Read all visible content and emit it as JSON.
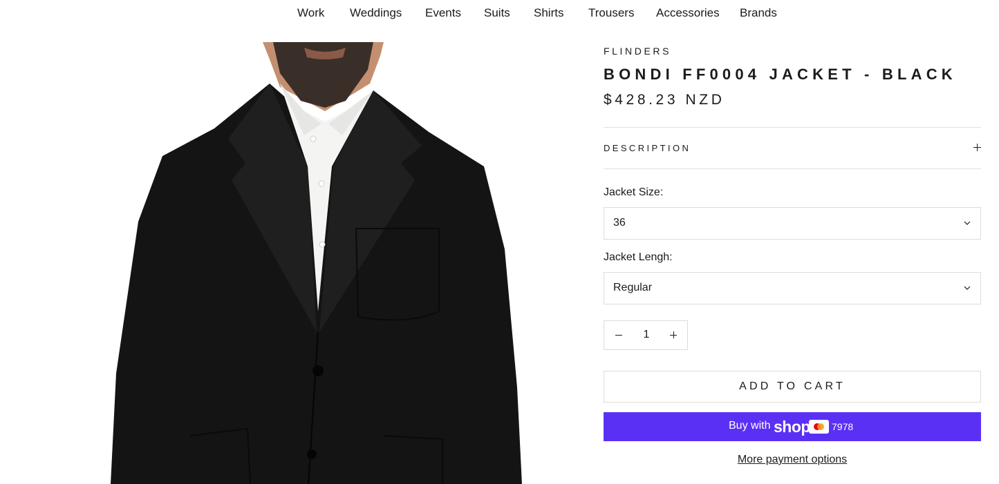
{
  "nav": {
    "items": [
      "Work",
      "Weddings",
      "Events",
      "Suits",
      "Shirts",
      "Trousers",
      "Accessories",
      "Brands"
    ]
  },
  "product": {
    "vendor": "FLINDERS",
    "title": "BONDI FF0004 JACKET - BLACK",
    "price": "$428.23 NZD",
    "description_label": "DESCRIPTION",
    "jacket_size_label": "Jacket Size:",
    "jacket_size_value": "36",
    "jacket_length_label": "Jacket Lengh:",
    "jacket_length_value": "Regular",
    "quantity": "1",
    "add_to_cart_label": "ADD TO CART",
    "shop_pay": {
      "prefix": "Buy with",
      "logo_text": "shop",
      "card_last4": "7978",
      "color": "#5a31f4"
    },
    "more_payment_label": "More payment options"
  },
  "icons": {
    "description_toggle": "plus-icon",
    "select_arrow": "chevron-down-icon",
    "quantity_decrease": "minus-icon",
    "quantity_increase": "plus-icon",
    "card": "mastercard-icon"
  }
}
